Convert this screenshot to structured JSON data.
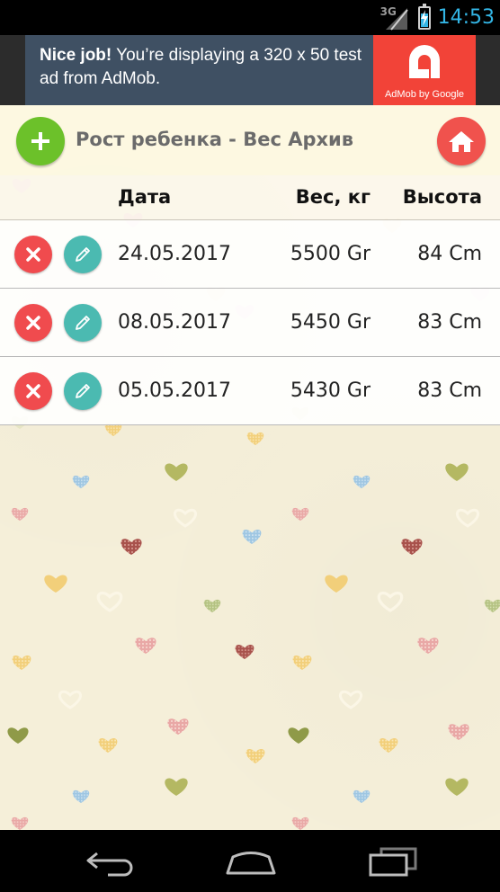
{
  "status_bar": {
    "network": "3G",
    "time": "14:53",
    "battery_level": 0.75
  },
  "ad": {
    "headline": "Nice job!",
    "text": "You’re displaying a 320 x 50 test ad from AdMob.",
    "brand": "AdMob by Google"
  },
  "header": {
    "title": "Рост ребенка - Вес Архив"
  },
  "table": {
    "columns": {
      "date": "Дата",
      "weight": "Вес, кг",
      "height": "Высота"
    },
    "rows": [
      {
        "date": "24.05.2017",
        "weight": "5500 Gr",
        "height": "84 Cm"
      },
      {
        "date": "08.05.2017",
        "weight": "5450 Gr",
        "height": "83 Cm"
      },
      {
        "date": "05.05.2017",
        "weight": "5430 Gr",
        "height": "83 Cm"
      }
    ]
  },
  "colors": {
    "add": "#6cc12a",
    "home": "#f0524d",
    "delete": "#f04b4e",
    "edit": "#4bbab1",
    "background": "#f5efd9",
    "accent": "#33b5e5"
  }
}
